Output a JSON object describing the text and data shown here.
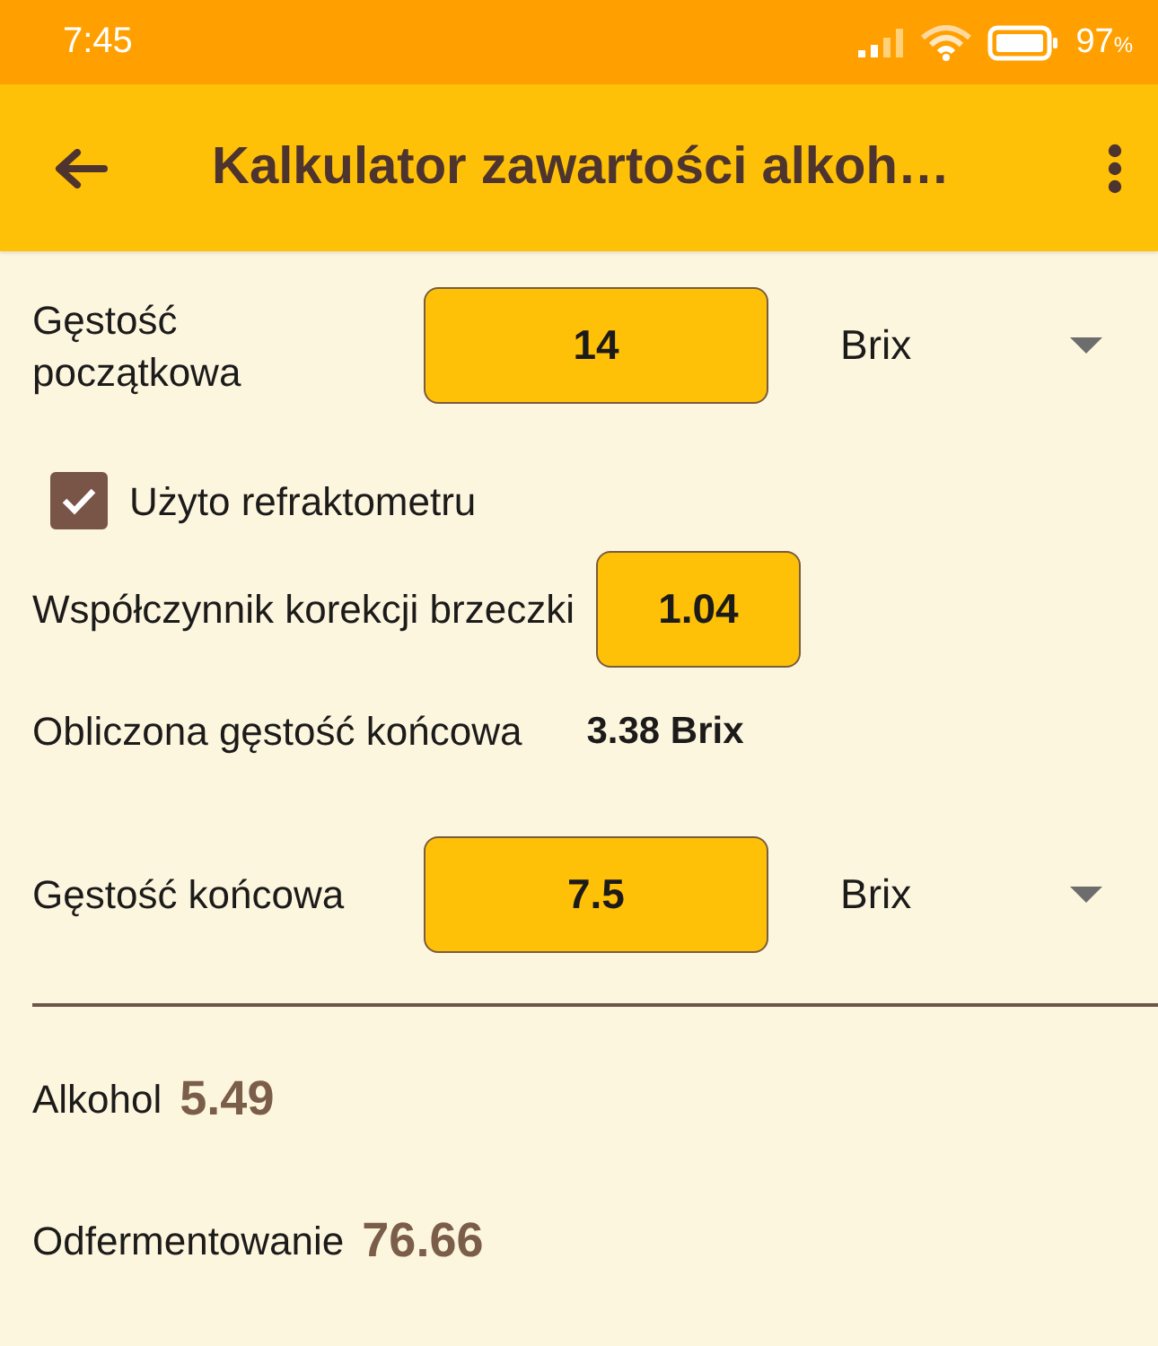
{
  "status_bar": {
    "time": "7:45",
    "battery_percent": "97",
    "battery_unit": "%"
  },
  "app_bar": {
    "title": "Kalkulator zawartości alkoh…"
  },
  "fields": [
    {
      "kind": "measurement",
      "label": "Gęstość początkowa",
      "value": "14",
      "unit": "Brix"
    },
    {
      "kind": "checkbox",
      "label": "Użyto refraktometru",
      "checked": true
    },
    {
      "kind": "factor",
      "label": "Współczynnik korekcji brzeczki",
      "value": "1.04"
    },
    {
      "kind": "computed",
      "label": "Obliczona gęstość końcowa",
      "value": "3.38 Brix"
    },
    {
      "kind": "measurement",
      "label": "Gęstość końcowa",
      "value": "7.5",
      "unit": "Brix"
    }
  ],
  "results": [
    {
      "label": "Alkohol",
      "value": "5.49"
    },
    {
      "label": "Odfermentowanie",
      "value": "76.66"
    }
  ]
}
